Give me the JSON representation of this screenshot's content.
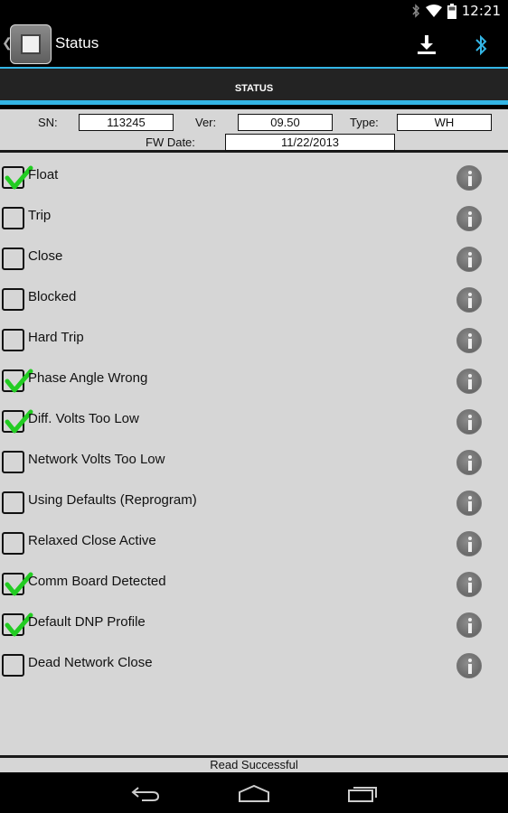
{
  "statusbar": {
    "time": "12:21",
    "icons": [
      "bluetooth-icon",
      "wifi-icon",
      "battery-icon"
    ]
  },
  "actionbar": {
    "title": "Status",
    "actions": [
      "download-icon",
      "bluetooth-icon"
    ]
  },
  "tab": {
    "label": "STATUS"
  },
  "info": {
    "sn_label": "SN:",
    "sn_value": "113245",
    "ver_label": "Ver:",
    "ver_value": "09.50",
    "type_label": "Type:",
    "type_value": "WH",
    "fw_label": "FW Date:",
    "fw_value": "11/22/2013"
  },
  "items": [
    {
      "label": "Float",
      "checked": true
    },
    {
      "label": "Trip",
      "checked": false
    },
    {
      "label": "Close",
      "checked": false
    },
    {
      "label": "Blocked",
      "checked": false
    },
    {
      "label": "Hard Trip",
      "checked": false
    },
    {
      "label": "Phase Angle Wrong",
      "checked": true
    },
    {
      "label": "Diff. Volts Too Low",
      "checked": true
    },
    {
      "label": "Network Volts Too Low",
      "checked": false
    },
    {
      "label": "Using Defaults (Reprogram)",
      "checked": false
    },
    {
      "label": "Relaxed Close Active",
      "checked": false
    },
    {
      "label": "Comm Board Detected",
      "checked": true
    },
    {
      "label": "Default DNP Profile",
      "checked": true
    },
    {
      "label": "Dead Network Close",
      "checked": false
    }
  ],
  "footer": {
    "status": "Read Successful"
  },
  "colors": {
    "accent": "#33b5e5",
    "check": "#22cc22",
    "background": "#d6d6d6"
  }
}
